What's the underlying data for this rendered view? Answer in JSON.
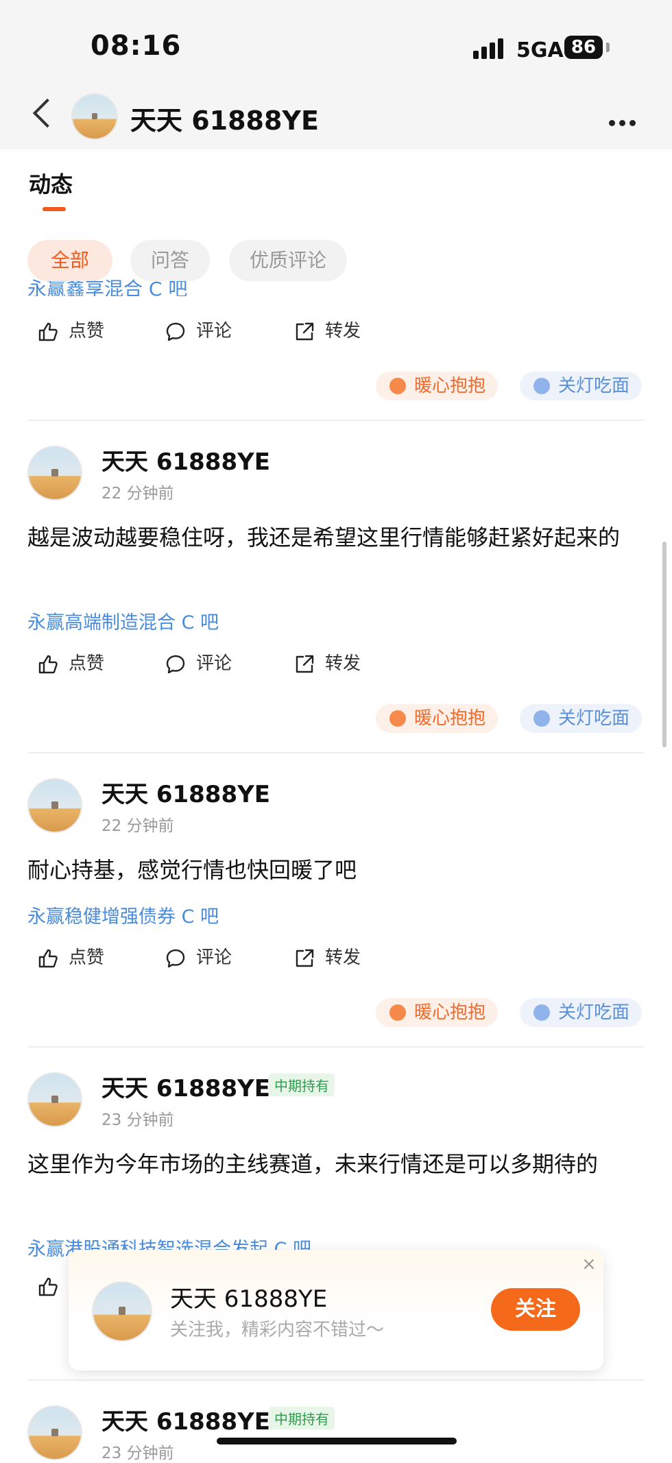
{
  "status_bar": {
    "time": "08:16",
    "network": "5GA",
    "battery": "86"
  },
  "header": {
    "title": "天天 61888YE"
  },
  "tabs": {
    "title": "动态"
  },
  "filters": [
    {
      "label": "全部",
      "active": true
    },
    {
      "label": "问答",
      "active": false
    },
    {
      "label": "优质评论",
      "active": false
    }
  ],
  "prev_post": {
    "topic": "永赢鑫享混合 C 吧"
  },
  "actions": {
    "like": "点赞",
    "comment": "评论",
    "share": "转发"
  },
  "stickers": {
    "warm": "暖心抱抱",
    "cool": "关灯吃面"
  },
  "posts": [
    {
      "author": "天天 61888YE",
      "time": "22 分钟前",
      "badge": "",
      "content": "越是波动越要稳住呀，我还是希望这里行情能够赶紧好起来的",
      "topic": "永赢高端制造混合 C 吧"
    },
    {
      "author": "天天 61888YE",
      "time": "22 分钟前",
      "badge": "",
      "content": "耐心持基，感觉行情也快回暖了吧",
      "topic": "永赢稳健增强债券 C 吧"
    },
    {
      "author": "天天 61888YE",
      "time": "23 分钟前",
      "badge": "中期持有",
      "content": "这里作为今年市场的主线赛道，未来行情还是可以多期待的",
      "topic": "永赢港股通科技智选混合发起 C 吧"
    },
    {
      "author": "天天 61888YE",
      "time": "23 分钟前",
      "badge": "中期持有"
    }
  ],
  "follow_popup": {
    "name": "天天 61888YE",
    "subtitle": "关注我，精彩内容不错过～",
    "button": "关注",
    "close": "×"
  }
}
